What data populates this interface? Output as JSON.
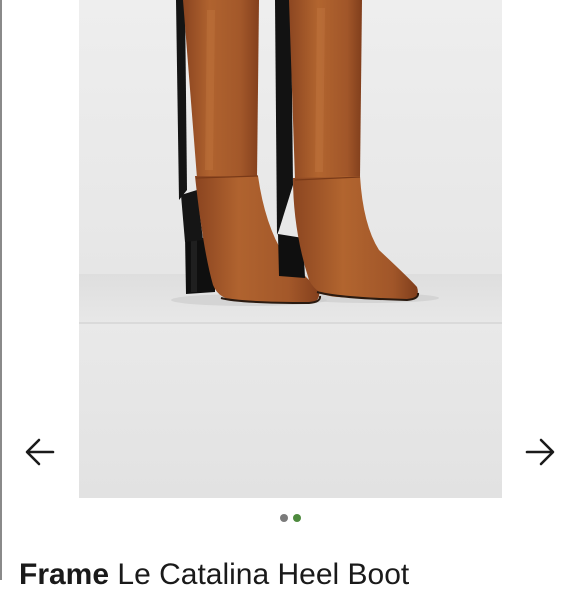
{
  "colors": {
    "dot_inactive": "#7b7b7b",
    "dot_active": "#4e8a3e",
    "arrow": "#1a1a1a",
    "leather": "#a8582c",
    "sole_heel": "#111111"
  },
  "icons": {
    "prev": "arrow-left-icon",
    "next": "arrow-right-icon"
  },
  "carousel": {
    "image_count": 2,
    "active_index": 1
  },
  "listing": {
    "brand": "Frame",
    "title": "Le Catalina Heel Boot"
  }
}
